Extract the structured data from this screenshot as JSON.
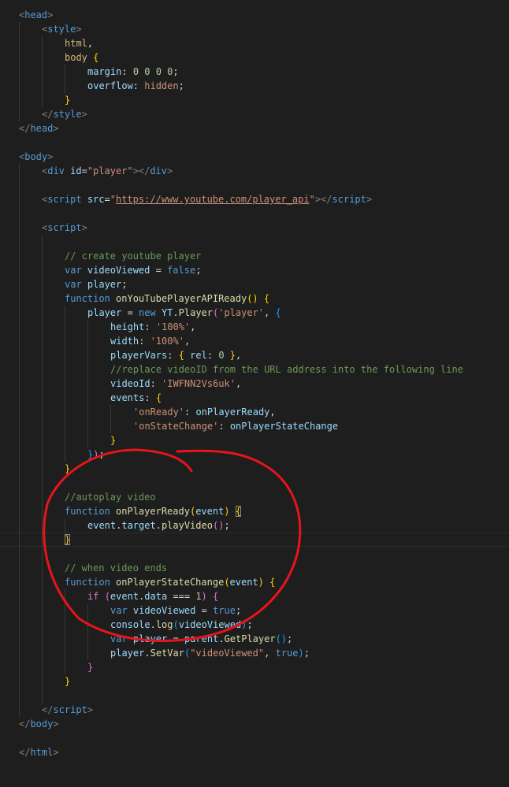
{
  "editor": {
    "current_line": 38,
    "lines": [
      {
        "i": 0,
        "t": [
          [
            "p",
            "<"
          ],
          [
            "tg",
            "head"
          ],
          [
            "p",
            ">"
          ]
        ]
      },
      {
        "i": 1,
        "t": [
          [
            "p",
            "<"
          ],
          [
            "tg",
            "style"
          ],
          [
            "p",
            ">"
          ]
        ]
      },
      {
        "i": 2,
        "t": [
          [
            "sel",
            "html"
          ],
          [
            "d",
            ","
          ]
        ]
      },
      {
        "i": 2,
        "t": [
          [
            "sel",
            "body "
          ],
          [
            "b1",
            "{"
          ]
        ]
      },
      {
        "i": 3,
        "t": [
          [
            "at",
            "margin"
          ],
          [
            "d",
            ": "
          ],
          [
            "n",
            "0 0 0 0"
          ],
          [
            "d",
            ";"
          ]
        ]
      },
      {
        "i": 3,
        "t": [
          [
            "at",
            "overflow"
          ],
          [
            "d",
            ": "
          ],
          [
            "s",
            "hidden"
          ],
          [
            "d",
            ";"
          ]
        ]
      },
      {
        "i": 2,
        "t": [
          [
            "b1",
            "}"
          ]
        ]
      },
      {
        "i": 1,
        "t": [
          [
            "p",
            "</"
          ],
          [
            "tg",
            "style"
          ],
          [
            "p",
            ">"
          ]
        ]
      },
      {
        "i": 0,
        "t": [
          [
            "p",
            "</"
          ],
          [
            "tg",
            "head"
          ],
          [
            "p",
            ">"
          ]
        ]
      },
      {
        "i": 0,
        "t": []
      },
      {
        "i": 0,
        "t": [
          [
            "p",
            "<"
          ],
          [
            "tg",
            "body"
          ],
          [
            "p",
            ">"
          ]
        ]
      },
      {
        "i": 1,
        "t": [
          [
            "p",
            "<"
          ],
          [
            "tg",
            "div "
          ],
          [
            "at",
            "id"
          ],
          [
            "d",
            "="
          ],
          [
            "s",
            "\"player\""
          ],
          [
            "p",
            "></"
          ],
          [
            "tg",
            "div"
          ],
          [
            "p",
            ">"
          ]
        ]
      },
      {
        "i": 1,
        "t": []
      },
      {
        "i": 1,
        "t": [
          [
            "p",
            "<"
          ],
          [
            "tg",
            "script "
          ],
          [
            "at",
            "src"
          ],
          [
            "d",
            "="
          ],
          [
            "s",
            "\""
          ],
          [
            "u",
            "https://www.youtube.com/player_api"
          ],
          [
            "s",
            "\""
          ],
          [
            "p",
            "></"
          ],
          [
            "tg",
            "script"
          ],
          [
            "p",
            ">"
          ]
        ]
      },
      {
        "i": 1,
        "t": []
      },
      {
        "i": 1,
        "t": [
          [
            "p",
            "<"
          ],
          [
            "tg",
            "script"
          ],
          [
            "p",
            ">"
          ]
        ]
      },
      {
        "i": 2,
        "t": []
      },
      {
        "i": 2,
        "t": [
          [
            "c",
            "// create youtube player"
          ]
        ]
      },
      {
        "i": 2,
        "t": [
          [
            "k",
            "var "
          ],
          [
            "v",
            "videoViewed"
          ],
          [
            "d",
            " = "
          ],
          [
            "k",
            "false"
          ],
          [
            "d",
            ";"
          ]
        ]
      },
      {
        "i": 2,
        "t": [
          [
            "k",
            "var "
          ],
          [
            "v",
            "player"
          ],
          [
            "d",
            ";"
          ]
        ]
      },
      {
        "i": 2,
        "t": [
          [
            "k",
            "function "
          ],
          [
            "fn",
            "onYouTubePlayerAPIReady"
          ],
          [
            "b1",
            "()"
          ],
          [
            "d",
            " "
          ],
          [
            "b1",
            "{"
          ]
        ]
      },
      {
        "i": 3,
        "t": [
          [
            "v",
            "player"
          ],
          [
            "d",
            " = "
          ],
          [
            "k",
            "new "
          ],
          [
            "v",
            "YT"
          ],
          [
            "d",
            "."
          ],
          [
            "fn",
            "Player"
          ],
          [
            "b2",
            "("
          ],
          [
            "s",
            "'player'"
          ],
          [
            "d",
            ", "
          ],
          [
            "b3",
            "{"
          ]
        ]
      },
      {
        "i": 4,
        "t": [
          [
            "v",
            "height"
          ],
          [
            "d",
            ": "
          ],
          [
            "s",
            "'100%'"
          ],
          [
            "d",
            ","
          ]
        ]
      },
      {
        "i": 4,
        "t": [
          [
            "v",
            "width"
          ],
          [
            "d",
            ": "
          ],
          [
            "s",
            "'100%'"
          ],
          [
            "d",
            ","
          ]
        ]
      },
      {
        "i": 4,
        "t": [
          [
            "v",
            "playerVars"
          ],
          [
            "d",
            ": "
          ],
          [
            "b1",
            "{"
          ],
          [
            "d",
            " "
          ],
          [
            "v",
            "rel"
          ],
          [
            "d",
            ": "
          ],
          [
            "n",
            "0"
          ],
          [
            "d",
            " "
          ],
          [
            "b1",
            "}"
          ],
          [
            "d",
            ","
          ]
        ]
      },
      {
        "i": 4,
        "t": [
          [
            "c",
            "//replace videoID from the URL address into the following line"
          ]
        ]
      },
      {
        "i": 4,
        "t": [
          [
            "v",
            "videoId"
          ],
          [
            "d",
            ": "
          ],
          [
            "s",
            "'IWFNN2Vs6uk'"
          ],
          [
            "d",
            ","
          ]
        ]
      },
      {
        "i": 4,
        "t": [
          [
            "v",
            "events"
          ],
          [
            "d",
            ": "
          ],
          [
            "b1",
            "{"
          ]
        ]
      },
      {
        "i": 5,
        "t": [
          [
            "s",
            "'onReady'"
          ],
          [
            "d",
            ": "
          ],
          [
            "v",
            "onPlayerReady"
          ],
          [
            "d",
            ","
          ]
        ]
      },
      {
        "i": 5,
        "t": [
          [
            "s",
            "'onStateChange'"
          ],
          [
            "d",
            ": "
          ],
          [
            "v",
            "onPlayerStateChange"
          ]
        ]
      },
      {
        "i": 4,
        "t": [
          [
            "b1",
            "}"
          ]
        ]
      },
      {
        "i": 3,
        "t": [
          [
            "b3",
            "}"
          ],
          [
            "b2",
            ")"
          ],
          [
            "d",
            ";"
          ]
        ]
      },
      {
        "i": 2,
        "t": [
          [
            "b1",
            "}"
          ]
        ]
      },
      {
        "i": 2,
        "t": []
      },
      {
        "i": 2,
        "t": [
          [
            "c",
            "//autoplay video"
          ]
        ]
      },
      {
        "i": 2,
        "t": [
          [
            "k",
            "function "
          ],
          [
            "fn",
            "onPlayerReady"
          ],
          [
            "b1",
            "("
          ],
          [
            "v",
            "event"
          ],
          [
            "b1",
            ")"
          ],
          [
            "d",
            " "
          ],
          [
            "b1 bm",
            "{"
          ]
        ]
      },
      {
        "i": 3,
        "t": [
          [
            "v",
            "event"
          ],
          [
            "d",
            "."
          ],
          [
            "v",
            "target"
          ],
          [
            "d",
            "."
          ],
          [
            "fn",
            "playVideo"
          ],
          [
            "b2",
            "()"
          ],
          [
            "d",
            ";"
          ]
        ]
      },
      {
        "i": 2,
        "t": [
          [
            "b1 bm",
            "}"
          ]
        ]
      },
      {
        "i": 2,
        "t": []
      },
      {
        "i": 2,
        "t": [
          [
            "c",
            "// when video ends"
          ]
        ]
      },
      {
        "i": 2,
        "t": [
          [
            "k",
            "function "
          ],
          [
            "fn",
            "onPlayerStateChange"
          ],
          [
            "b1",
            "("
          ],
          [
            "v",
            "event"
          ],
          [
            "b1",
            ")"
          ],
          [
            "d",
            " "
          ],
          [
            "b1",
            "{"
          ]
        ]
      },
      {
        "i": 3,
        "t": [
          [
            "ct",
            "if "
          ],
          [
            "b2",
            "("
          ],
          [
            "v",
            "event"
          ],
          [
            "d",
            "."
          ],
          [
            "v",
            "data"
          ],
          [
            "d",
            " === "
          ],
          [
            "n",
            "1"
          ],
          [
            "b2",
            ")"
          ],
          [
            "d",
            " "
          ],
          [
            "b2",
            "{"
          ]
        ]
      },
      {
        "i": 4,
        "t": [
          [
            "k",
            "var "
          ],
          [
            "v",
            "videoViewed"
          ],
          [
            "d",
            " = "
          ],
          [
            "k",
            "true"
          ],
          [
            "d",
            ";"
          ]
        ]
      },
      {
        "i": 4,
        "t": [
          [
            "v",
            "console"
          ],
          [
            "d",
            "."
          ],
          [
            "fn",
            "log"
          ],
          [
            "b3",
            "("
          ],
          [
            "v",
            "videoViewed"
          ],
          [
            "b3",
            ")"
          ],
          [
            "d",
            ";"
          ]
        ]
      },
      {
        "i": 4,
        "t": [
          [
            "k",
            "var "
          ],
          [
            "v",
            "player"
          ],
          [
            "d",
            " = "
          ],
          [
            "v",
            "parent"
          ],
          [
            "d",
            "."
          ],
          [
            "fn",
            "GetPlayer"
          ],
          [
            "b3",
            "()"
          ],
          [
            "d",
            ";"
          ]
        ]
      },
      {
        "i": 4,
        "t": [
          [
            "v",
            "player"
          ],
          [
            "d",
            "."
          ],
          [
            "fn",
            "SetVar"
          ],
          [
            "b3",
            "("
          ],
          [
            "s",
            "\"videoViewed\""
          ],
          [
            "d",
            ", "
          ],
          [
            "k",
            "true"
          ],
          [
            "b3",
            ")"
          ],
          [
            "d",
            ";"
          ]
        ]
      },
      {
        "i": 3,
        "t": [
          [
            "b2",
            "}"
          ]
        ]
      },
      {
        "i": 2,
        "t": [
          [
            "b1",
            "}"
          ]
        ]
      },
      {
        "i": 2,
        "t": []
      },
      {
        "i": 1,
        "t": [
          [
            "p",
            "</"
          ],
          [
            "tg",
            "script"
          ],
          [
            "p",
            ">"
          ]
        ]
      },
      {
        "i": 0,
        "t": [
          [
            "p",
            "</"
          ],
          [
            "tg",
            "body"
          ],
          [
            "p",
            ">"
          ]
        ]
      },
      {
        "i": 0,
        "t": []
      },
      {
        "i": 0,
        "t": [
          [
            "p",
            "</"
          ],
          [
            "tg",
            "html"
          ],
          [
            "p",
            ">"
          ]
        ]
      }
    ]
  },
  "annotation": {
    "color": "#e8141b"
  }
}
